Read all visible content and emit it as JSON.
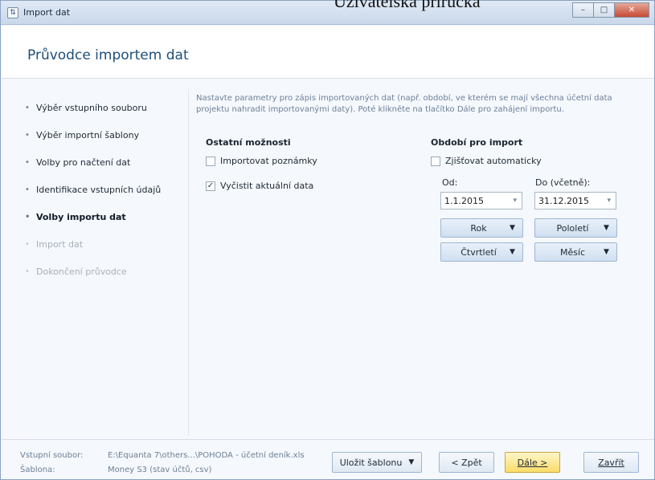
{
  "overlay": {
    "caption": "Uzivatelska prirucka"
  },
  "window": {
    "title": "Import dat",
    "controls": {
      "minimize": "–",
      "maximize": "□",
      "close": "✕"
    }
  },
  "header": {
    "title": "Průvodce importem dat"
  },
  "steps": [
    {
      "label": "Výběr vstupního souboru"
    },
    {
      "label": "Výběr importní šablony"
    },
    {
      "label": "Volby pro načtení dat"
    },
    {
      "label": "Identifikace vstupních údajů"
    },
    {
      "label": "Volby importu dat"
    },
    {
      "label": "Import dat"
    },
    {
      "label": "Dokončení průvodce"
    }
  ],
  "intro": "Nastavte parametry pro zápis importovaných dat (např. období, ve kterém se mají všechna účetní data projektu nahradit importovanými daty). Poté klikněte na tlačítko Dále pro zahájení importu.",
  "other_options": {
    "title": "Ostatní možnosti",
    "import_notes": {
      "label": "Importovat poznámky",
      "checked": false
    },
    "clear_data": {
      "label": "Vyčistit aktuální data",
      "checked": true
    }
  },
  "period": {
    "title": "Období pro import",
    "auto": {
      "label": "Zjišťovat automaticky",
      "checked": false
    },
    "from_label": "Od:",
    "to_label": "Do (včetně):",
    "from_value": "1.1.2015",
    "to_value": "31.12.2015",
    "buttons": {
      "year": "Rok",
      "half": "Pololetí",
      "quarter": "Čtvrtletí",
      "month": "Měsíc"
    }
  },
  "footer": {
    "input_label": "Vstupní soubor:",
    "input_value": "E:\\Equanta 7\\others...\\POHODA - účetní deník.xls",
    "template_label": "Šablona:",
    "template_value": "Money S3 (stav účtů, csv)",
    "save_template": "Uložit šablonu",
    "back": "< Zpět",
    "next": "Dále >",
    "close": "Zavřít"
  },
  "colors": {
    "accent": "#1e4f7a",
    "primary_button": "#f9dc6a",
    "window_border": "#8aa2c0"
  }
}
